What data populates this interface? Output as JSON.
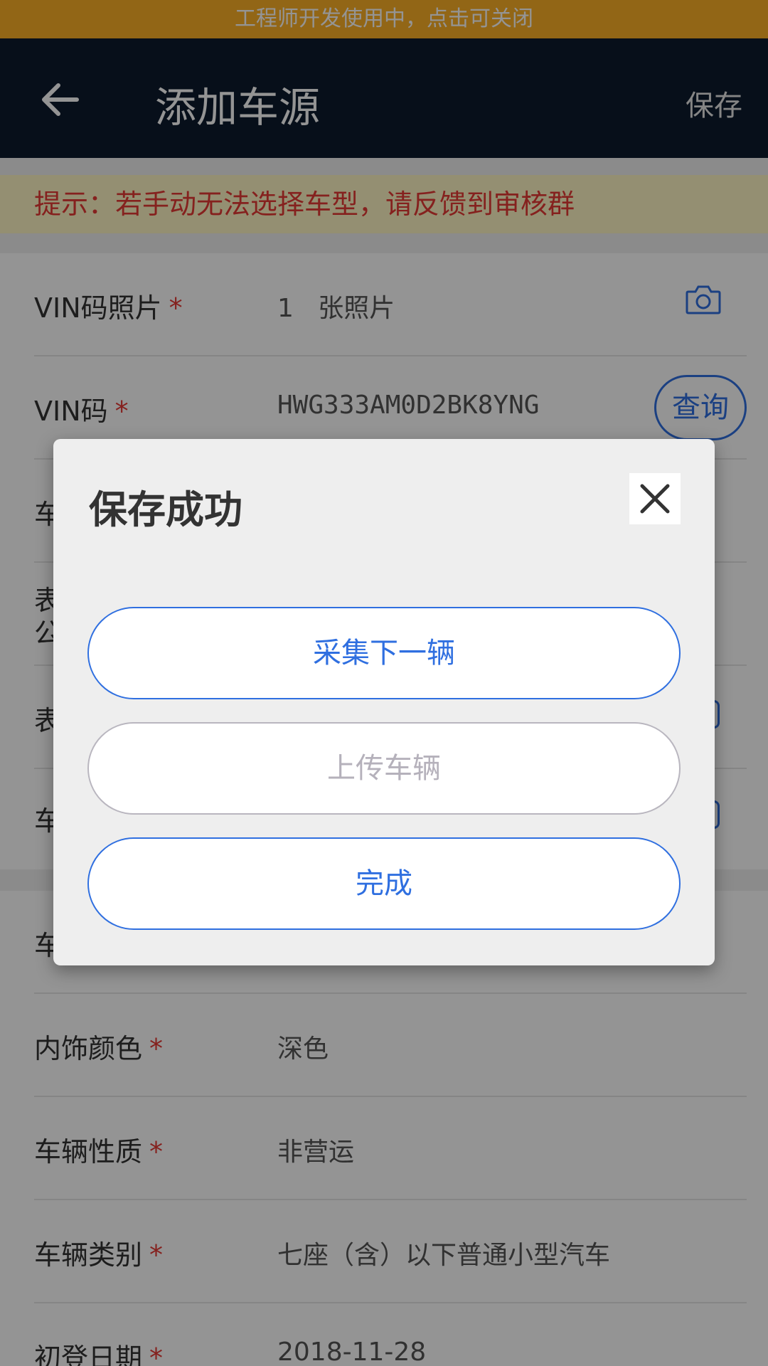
{
  "banner": {
    "text": "工程师开发使用中，点击可关闭"
  },
  "appbar": {
    "title": "添加车源",
    "save_label": "保存"
  },
  "notice": {
    "text": "提示：若手动无法选择车型，请反馈到审核群"
  },
  "form": {
    "vin_photo": {
      "label": "VIN码照片",
      "required": "*",
      "count": "1",
      "unit": "张照片"
    },
    "vin": {
      "label": "VIN码",
      "required": "*",
      "value": "HWG333AM0D2BK8YNG",
      "query_label": "查询"
    },
    "row3_label": "车",
    "row4_label_line1": "表",
    "row4_label_line2": "公",
    "row5_label": "表",
    "row6_label": "车",
    "row7_label": "车",
    "interior": {
      "label": "内饰颜色",
      "required": "*",
      "value": "深色"
    },
    "nature": {
      "label": "车辆性质",
      "required": "*",
      "value": "非营运"
    },
    "category": {
      "label": "车辆类别",
      "required": "*",
      "value": "七座（含）以下普通小型汽车"
    },
    "reg_date": {
      "label": "初登日期",
      "required": "*",
      "value": "2018-11-28"
    }
  },
  "dialog": {
    "title": "保存成功",
    "btn_next": "采集下一辆",
    "btn_upload": "上传车辆",
    "btn_done": "完成"
  },
  "colors": {
    "accent": "#2f6fe0",
    "banner": "#fbb027",
    "appbar": "#0d1a2e",
    "required": "#e53935"
  }
}
